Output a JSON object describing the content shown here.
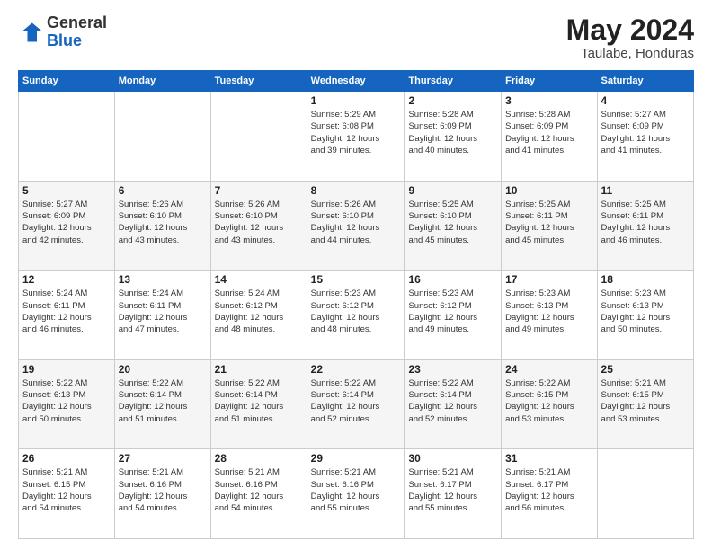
{
  "header": {
    "logo_line1": "General",
    "logo_line2": "Blue",
    "main_title": "May 2024",
    "subtitle": "Taulabe, Honduras"
  },
  "calendar": {
    "days_of_week": [
      "Sunday",
      "Monday",
      "Tuesday",
      "Wednesday",
      "Thursday",
      "Friday",
      "Saturday"
    ],
    "weeks": [
      [
        {
          "day": "",
          "info": ""
        },
        {
          "day": "",
          "info": ""
        },
        {
          "day": "",
          "info": ""
        },
        {
          "day": "1",
          "info": "Sunrise: 5:29 AM\nSunset: 6:08 PM\nDaylight: 12 hours\nand 39 minutes."
        },
        {
          "day": "2",
          "info": "Sunrise: 5:28 AM\nSunset: 6:09 PM\nDaylight: 12 hours\nand 40 minutes."
        },
        {
          "day": "3",
          "info": "Sunrise: 5:28 AM\nSunset: 6:09 PM\nDaylight: 12 hours\nand 41 minutes."
        },
        {
          "day": "4",
          "info": "Sunrise: 5:27 AM\nSunset: 6:09 PM\nDaylight: 12 hours\nand 41 minutes."
        }
      ],
      [
        {
          "day": "5",
          "info": "Sunrise: 5:27 AM\nSunset: 6:09 PM\nDaylight: 12 hours\nand 42 minutes."
        },
        {
          "day": "6",
          "info": "Sunrise: 5:26 AM\nSunset: 6:10 PM\nDaylight: 12 hours\nand 43 minutes."
        },
        {
          "day": "7",
          "info": "Sunrise: 5:26 AM\nSunset: 6:10 PM\nDaylight: 12 hours\nand 43 minutes."
        },
        {
          "day": "8",
          "info": "Sunrise: 5:26 AM\nSunset: 6:10 PM\nDaylight: 12 hours\nand 44 minutes."
        },
        {
          "day": "9",
          "info": "Sunrise: 5:25 AM\nSunset: 6:10 PM\nDaylight: 12 hours\nand 45 minutes."
        },
        {
          "day": "10",
          "info": "Sunrise: 5:25 AM\nSunset: 6:11 PM\nDaylight: 12 hours\nand 45 minutes."
        },
        {
          "day": "11",
          "info": "Sunrise: 5:25 AM\nSunset: 6:11 PM\nDaylight: 12 hours\nand 46 minutes."
        }
      ],
      [
        {
          "day": "12",
          "info": "Sunrise: 5:24 AM\nSunset: 6:11 PM\nDaylight: 12 hours\nand 46 minutes."
        },
        {
          "day": "13",
          "info": "Sunrise: 5:24 AM\nSunset: 6:11 PM\nDaylight: 12 hours\nand 47 minutes."
        },
        {
          "day": "14",
          "info": "Sunrise: 5:24 AM\nSunset: 6:12 PM\nDaylight: 12 hours\nand 48 minutes."
        },
        {
          "day": "15",
          "info": "Sunrise: 5:23 AM\nSunset: 6:12 PM\nDaylight: 12 hours\nand 48 minutes."
        },
        {
          "day": "16",
          "info": "Sunrise: 5:23 AM\nSunset: 6:12 PM\nDaylight: 12 hours\nand 49 minutes."
        },
        {
          "day": "17",
          "info": "Sunrise: 5:23 AM\nSunset: 6:13 PM\nDaylight: 12 hours\nand 49 minutes."
        },
        {
          "day": "18",
          "info": "Sunrise: 5:23 AM\nSunset: 6:13 PM\nDaylight: 12 hours\nand 50 minutes."
        }
      ],
      [
        {
          "day": "19",
          "info": "Sunrise: 5:22 AM\nSunset: 6:13 PM\nDaylight: 12 hours\nand 50 minutes."
        },
        {
          "day": "20",
          "info": "Sunrise: 5:22 AM\nSunset: 6:14 PM\nDaylight: 12 hours\nand 51 minutes."
        },
        {
          "day": "21",
          "info": "Sunrise: 5:22 AM\nSunset: 6:14 PM\nDaylight: 12 hours\nand 51 minutes."
        },
        {
          "day": "22",
          "info": "Sunrise: 5:22 AM\nSunset: 6:14 PM\nDaylight: 12 hours\nand 52 minutes."
        },
        {
          "day": "23",
          "info": "Sunrise: 5:22 AM\nSunset: 6:14 PM\nDaylight: 12 hours\nand 52 minutes."
        },
        {
          "day": "24",
          "info": "Sunrise: 5:22 AM\nSunset: 6:15 PM\nDaylight: 12 hours\nand 53 minutes."
        },
        {
          "day": "25",
          "info": "Sunrise: 5:21 AM\nSunset: 6:15 PM\nDaylight: 12 hours\nand 53 minutes."
        }
      ],
      [
        {
          "day": "26",
          "info": "Sunrise: 5:21 AM\nSunset: 6:15 PM\nDaylight: 12 hours\nand 54 minutes."
        },
        {
          "day": "27",
          "info": "Sunrise: 5:21 AM\nSunset: 6:16 PM\nDaylight: 12 hours\nand 54 minutes."
        },
        {
          "day": "28",
          "info": "Sunrise: 5:21 AM\nSunset: 6:16 PM\nDaylight: 12 hours\nand 54 minutes."
        },
        {
          "day": "29",
          "info": "Sunrise: 5:21 AM\nSunset: 6:16 PM\nDaylight: 12 hours\nand 55 minutes."
        },
        {
          "day": "30",
          "info": "Sunrise: 5:21 AM\nSunset: 6:17 PM\nDaylight: 12 hours\nand 55 minutes."
        },
        {
          "day": "31",
          "info": "Sunrise: 5:21 AM\nSunset: 6:17 PM\nDaylight: 12 hours\nand 56 minutes."
        },
        {
          "day": "",
          "info": ""
        }
      ]
    ]
  }
}
